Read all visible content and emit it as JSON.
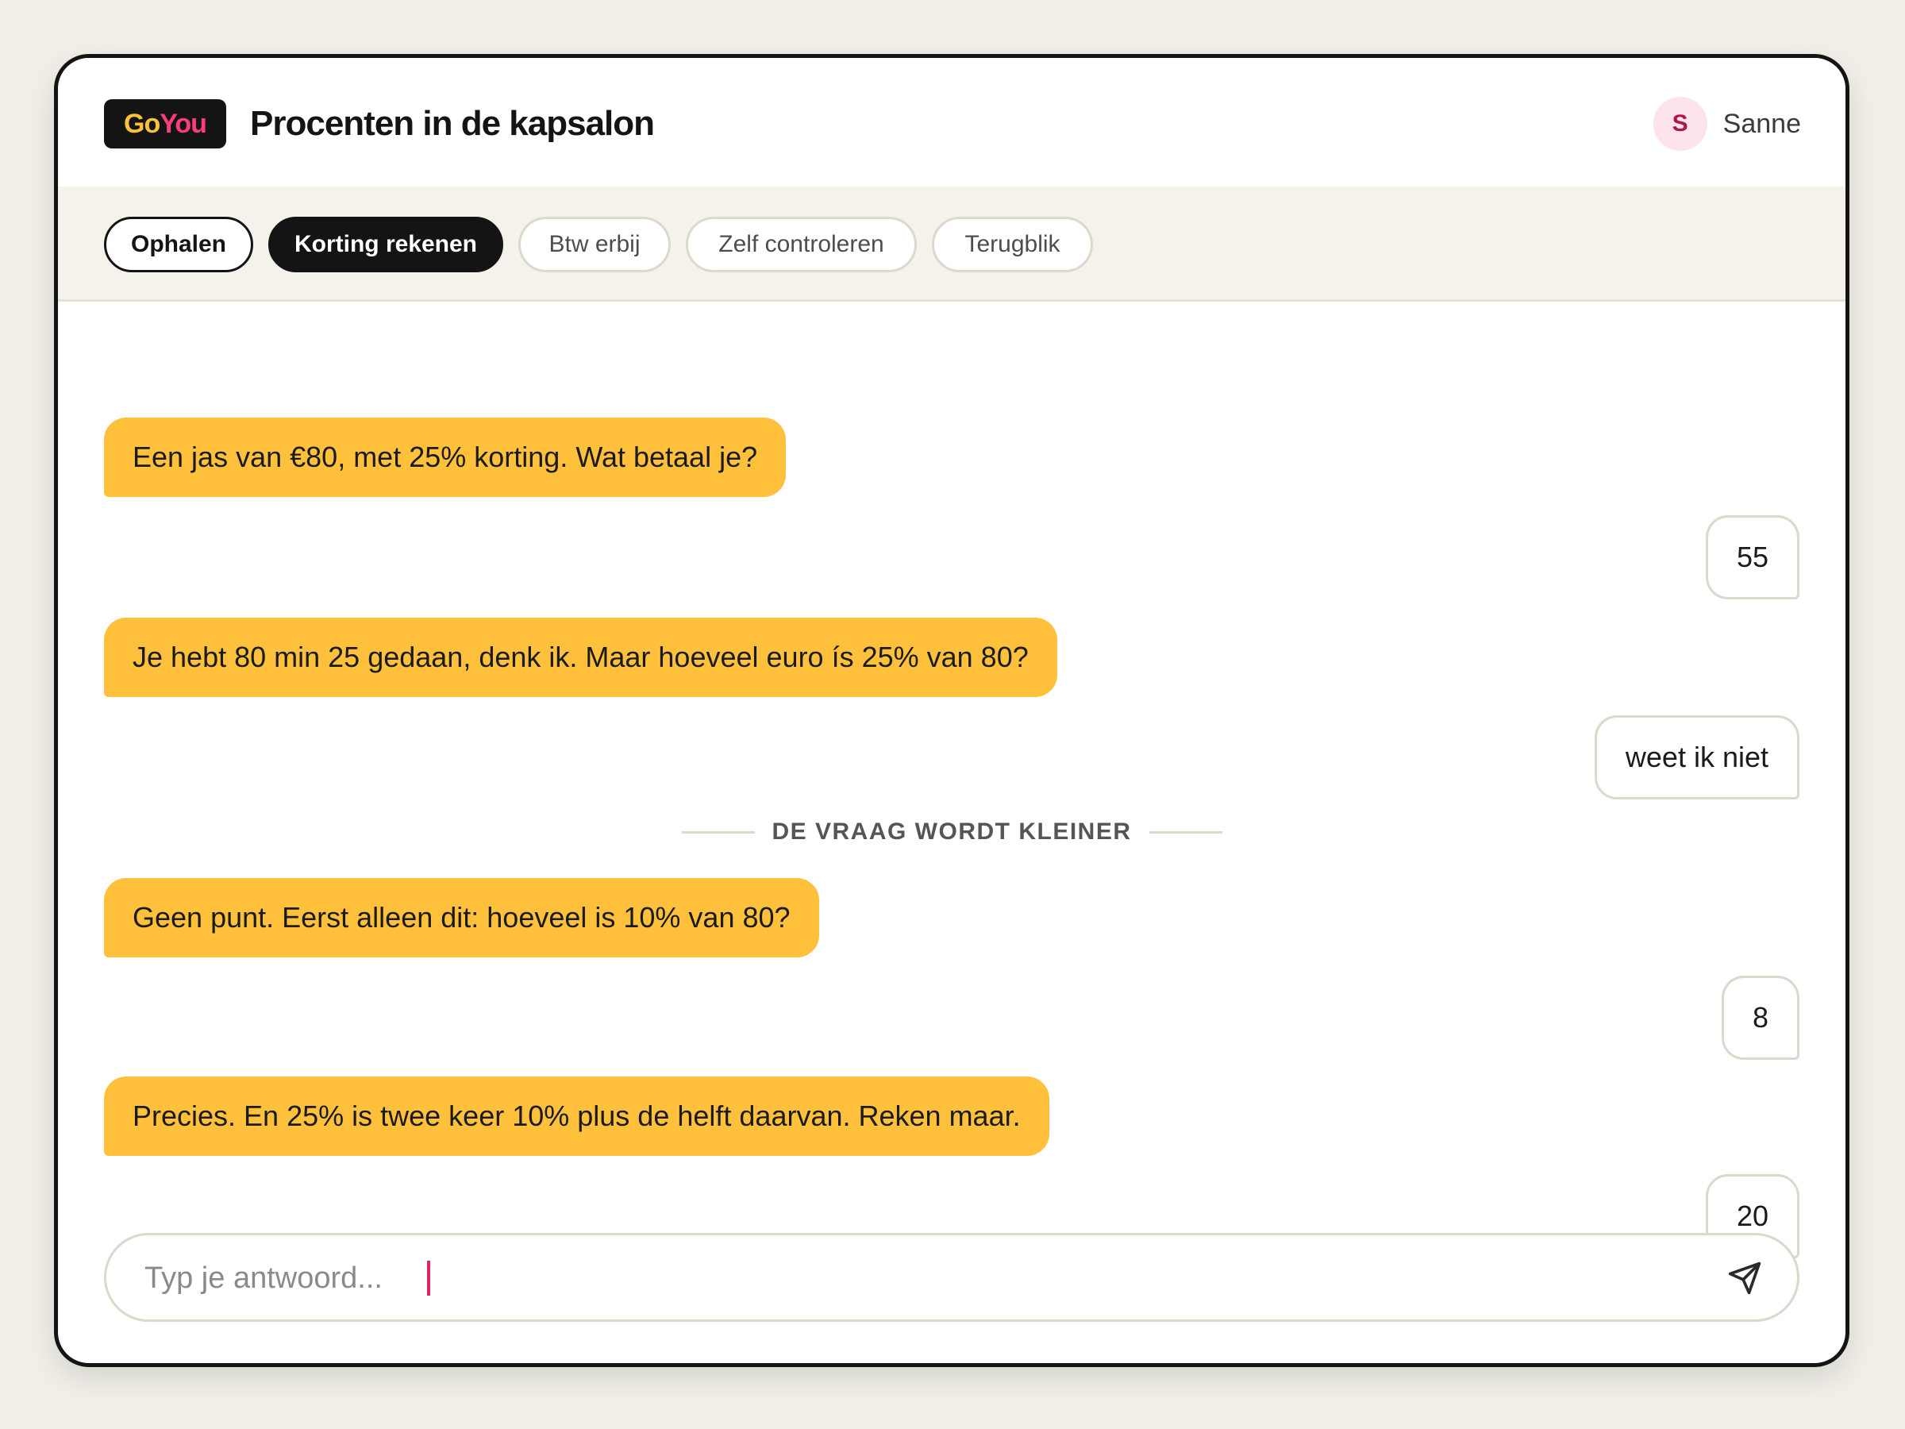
{
  "app": {
    "logo_go": "Go",
    "logo_you": "You",
    "title": "Procenten in de kapsalon"
  },
  "user": {
    "initial": "S",
    "name": "Sanne"
  },
  "tabs": [
    {
      "label": "Ophalen",
      "state": "done"
    },
    {
      "label": "Korting rekenen",
      "state": "active"
    },
    {
      "label": "Btw erbij",
      "state": "todo"
    },
    {
      "label": "Zelf controleren",
      "state": "todo"
    },
    {
      "label": "Terugblik",
      "state": "todo"
    }
  ],
  "messages": [
    {
      "role": "tutor",
      "text": "Een jas van €80, met 25% korting. Wat betaal je?"
    },
    {
      "role": "student",
      "text": "55"
    },
    {
      "role": "tutor",
      "text": "Je hebt 80 min 25 gedaan, denk ik. Maar hoeveel euro ís 25% van 80?"
    },
    {
      "role": "student",
      "text": "weet ik niet"
    },
    {
      "role": "tutor",
      "text": "Geen punt. Eerst alleen dit: hoeveel is 10% van 80?"
    },
    {
      "role": "student",
      "text": "8"
    },
    {
      "role": "tutor",
      "text": "Precies. En 25% is twee keer 10% plus de helft daarvan. Reken maar."
    },
    {
      "role": "student",
      "text": "20"
    }
  ],
  "divider": {
    "label": "DE VRAAG WORDT KLEINER"
  },
  "composer": {
    "placeholder": "Typ je antwoord...",
    "value": "",
    "send_icon": "send-icon"
  },
  "colors": {
    "accent_yellow": "#ffc13c",
    "accent_pink": "#ff3d7a",
    "dark": "#141414",
    "background": "#f1efe8"
  }
}
